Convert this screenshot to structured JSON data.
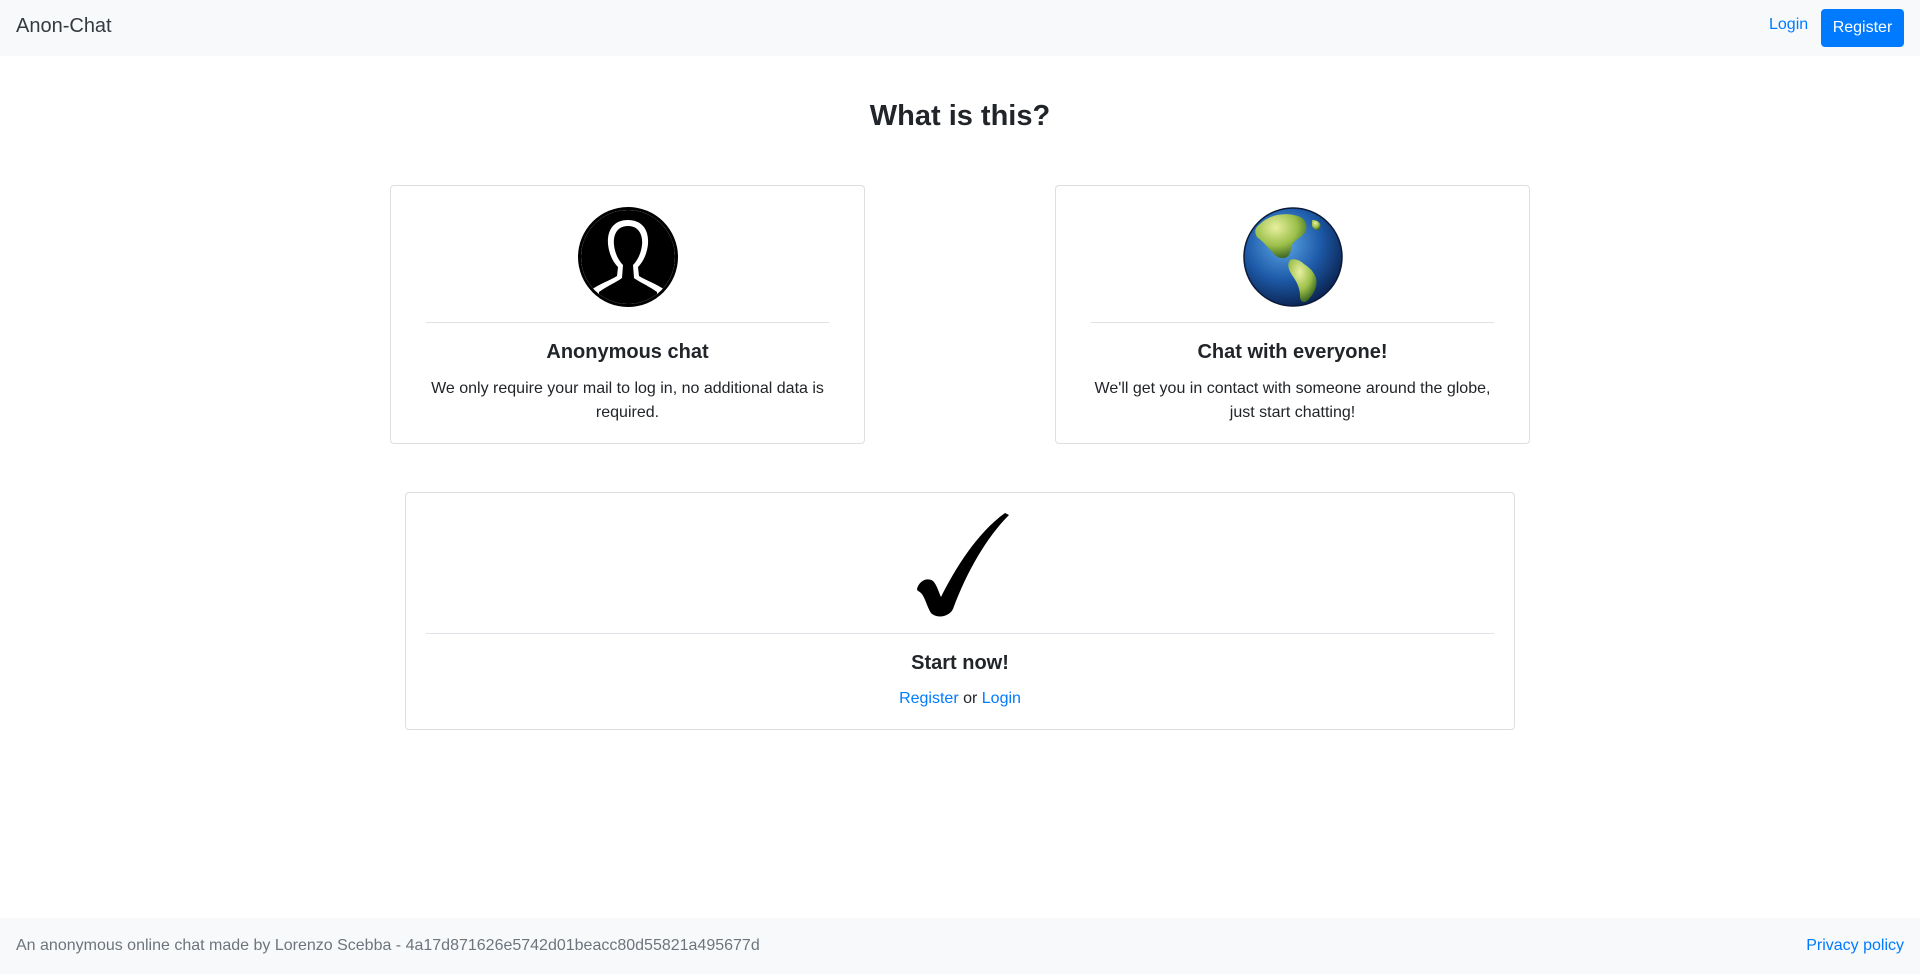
{
  "navbar": {
    "brand": "Anon-Chat",
    "login_label": "Login",
    "register_label": "Register"
  },
  "main": {
    "heading": "What is this?",
    "cards": [
      {
        "icon": "user-silhouette-icon",
        "title": "Anonymous chat",
        "text": "We only require your mail to log in, no additional data is required."
      },
      {
        "icon": "globe-icon",
        "title": "Chat with everyone!",
        "text": "We'll get you in contact with someone around the globe, just start chatting!"
      }
    ],
    "cta": {
      "icon": "checkmark-icon",
      "title": "Start now!",
      "register_label": "Register",
      "separator": "or",
      "login_label": "Login"
    }
  },
  "footer": {
    "text": "An anonymous online chat made by Lorenzo Scebba - 4a17d871626e5742d01beacc80d55821a495677d",
    "privacy_label": "Privacy policy"
  },
  "colors": {
    "primary": "#007bff",
    "navbar_bg": "#f8f9fa",
    "muted_text": "#6c757d"
  }
}
